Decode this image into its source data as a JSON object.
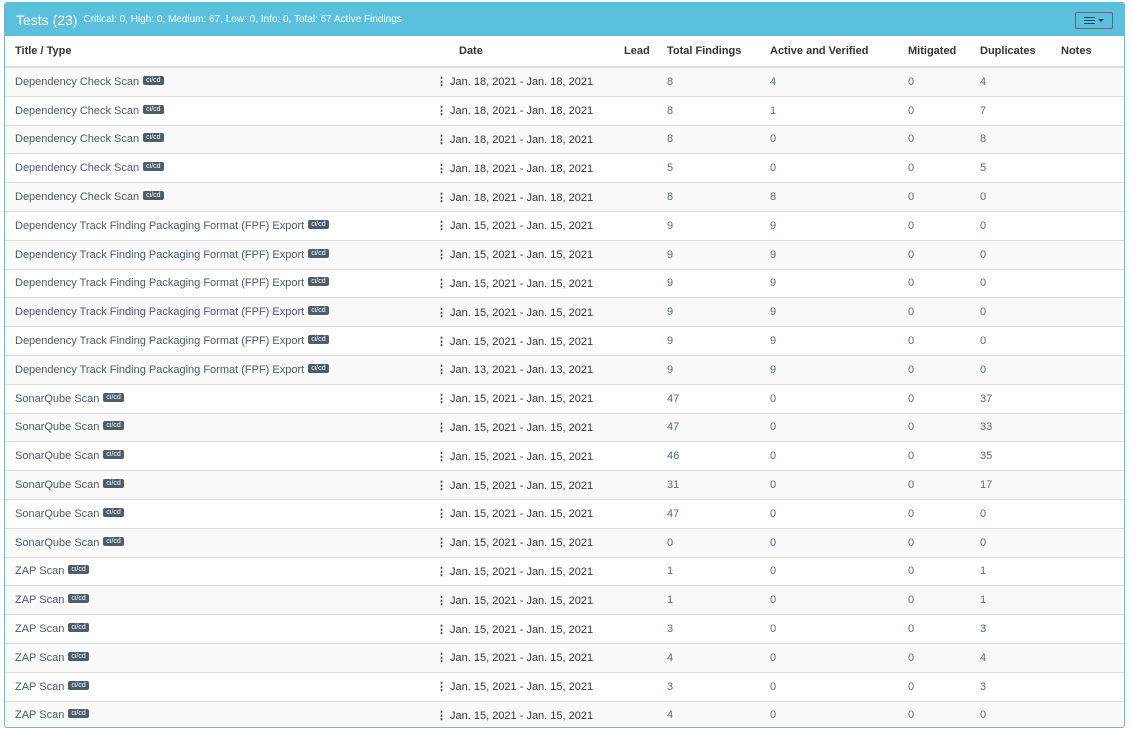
{
  "header": {
    "title": "Tests (23)",
    "summary": "Critical: 0, High: 0, Medium: 67, Low: 0, Info: 0, Total: 67 Active Findings"
  },
  "columns": [
    "Title / Type",
    "Date",
    "Lead",
    "Total Findings",
    "Active and Verified",
    "Mitigated",
    "Duplicates",
    "Notes"
  ],
  "badge_label": "ci/cd",
  "rows": [
    {
      "title": "Dependency Check Scan",
      "date": "Jan. 18, 2021 - Jan. 18, 2021",
      "lead": "",
      "total": "8",
      "active": "4",
      "mitigated": "0",
      "duplicates": "4",
      "notes": ""
    },
    {
      "title": "Dependency Check Scan",
      "date": "Jan. 18, 2021 - Jan. 18, 2021",
      "lead": "",
      "total": "8",
      "active": "1",
      "mitigated": "0",
      "duplicates": "7",
      "notes": ""
    },
    {
      "title": "Dependency Check Scan",
      "date": "Jan. 18, 2021 - Jan. 18, 2021",
      "lead": "",
      "total": "8",
      "active": "0",
      "mitigated": "0",
      "duplicates": "8",
      "notes": ""
    },
    {
      "title": "Dependency Check Scan",
      "date": "Jan. 18, 2021 - Jan. 18, 2021",
      "lead": "",
      "total": "5",
      "active": "0",
      "mitigated": "0",
      "duplicates": "5",
      "notes": ""
    },
    {
      "title": "Dependency Check Scan",
      "date": "Jan. 18, 2021 - Jan. 18, 2021",
      "lead": "",
      "total": "8",
      "active": "8",
      "mitigated": "0",
      "duplicates": "0",
      "notes": ""
    },
    {
      "title": "Dependency Track Finding Packaging Format (FPF) Export",
      "date": "Jan. 15, 2021 - Jan. 15, 2021",
      "lead": "",
      "total": "9",
      "active": "9",
      "mitigated": "0",
      "duplicates": "0",
      "notes": ""
    },
    {
      "title": "Dependency Track Finding Packaging Format (FPF) Export",
      "date": "Jan. 15, 2021 - Jan. 15, 2021",
      "lead": "",
      "total": "9",
      "active": "9",
      "mitigated": "0",
      "duplicates": "0",
      "notes": ""
    },
    {
      "title": "Dependency Track Finding Packaging Format (FPF) Export",
      "date": "Jan. 15, 2021 - Jan. 15, 2021",
      "lead": "",
      "total": "9",
      "active": "9",
      "mitigated": "0",
      "duplicates": "0",
      "notes": ""
    },
    {
      "title": "Dependency Track Finding Packaging Format (FPF) Export",
      "date": "Jan. 15, 2021 - Jan. 15, 2021",
      "lead": "",
      "total": "9",
      "active": "9",
      "mitigated": "0",
      "duplicates": "0",
      "notes": ""
    },
    {
      "title": "Dependency Track Finding Packaging Format (FPF) Export",
      "date": "Jan. 15, 2021 - Jan. 15, 2021",
      "lead": "",
      "total": "9",
      "active": "9",
      "mitigated": "0",
      "duplicates": "0",
      "notes": ""
    },
    {
      "title": "Dependency Track Finding Packaging Format (FPF) Export",
      "date": "Jan. 13, 2021 - Jan. 13, 2021",
      "lead": "",
      "total": "9",
      "active": "9",
      "mitigated": "0",
      "duplicates": "0",
      "notes": ""
    },
    {
      "title": "SonarQube Scan",
      "date": "Jan. 15, 2021 - Jan. 15, 2021",
      "lead": "",
      "total": "47",
      "active": "0",
      "mitigated": "0",
      "duplicates": "37",
      "notes": ""
    },
    {
      "title": "SonarQube Scan",
      "date": "Jan. 15, 2021 - Jan. 15, 2021",
      "lead": "",
      "total": "47",
      "active": "0",
      "mitigated": "0",
      "duplicates": "33",
      "notes": ""
    },
    {
      "title": "SonarQube Scan",
      "date": "Jan. 15, 2021 - Jan. 15, 2021",
      "lead": "",
      "total": "46",
      "active": "0",
      "mitigated": "0",
      "duplicates": "35",
      "notes": ""
    },
    {
      "title": "SonarQube Scan",
      "date": "Jan. 15, 2021 - Jan. 15, 2021",
      "lead": "",
      "total": "31",
      "active": "0",
      "mitigated": "0",
      "duplicates": "17",
      "notes": ""
    },
    {
      "title": "SonarQube Scan",
      "date": "Jan. 15, 2021 - Jan. 15, 2021",
      "lead": "",
      "total": "47",
      "active": "0",
      "mitigated": "0",
      "duplicates": "0",
      "notes": ""
    },
    {
      "title": "SonarQube Scan",
      "date": "Jan. 15, 2021 - Jan. 15, 2021",
      "lead": "",
      "total": "0",
      "active": "0",
      "mitigated": "0",
      "duplicates": "0",
      "notes": ""
    },
    {
      "title": "ZAP Scan",
      "date": "Jan. 15, 2021 - Jan. 15, 2021",
      "lead": "",
      "total": "1",
      "active": "0",
      "mitigated": "0",
      "duplicates": "1",
      "notes": ""
    },
    {
      "title": "ZAP Scan",
      "date": "Jan. 15, 2021 - Jan. 15, 2021",
      "lead": "",
      "total": "1",
      "active": "0",
      "mitigated": "0",
      "duplicates": "1",
      "notes": ""
    },
    {
      "title": "ZAP Scan",
      "date": "Jan. 15, 2021 - Jan. 15, 2021",
      "lead": "",
      "total": "3",
      "active": "0",
      "mitigated": "0",
      "duplicates": "3",
      "notes": ""
    },
    {
      "title": "ZAP Scan",
      "date": "Jan. 15, 2021 - Jan. 15, 2021",
      "lead": "",
      "total": "4",
      "active": "0",
      "mitigated": "0",
      "duplicates": "4",
      "notes": ""
    },
    {
      "title": "ZAP Scan",
      "date": "Jan. 15, 2021 - Jan. 15, 2021",
      "lead": "",
      "total": "3",
      "active": "0",
      "mitigated": "0",
      "duplicates": "3",
      "notes": ""
    },
    {
      "title": "ZAP Scan",
      "date": "Jan. 15, 2021 - Jan. 15, 2021",
      "lead": "",
      "total": "4",
      "active": "0",
      "mitigated": "0",
      "duplicates": "0",
      "notes": ""
    }
  ],
  "icons": {
    "menu": "hamburger-icon",
    "menu_caret": "caret-down-icon",
    "row_actions": "kebab-icon"
  },
  "colors": {
    "header_bg": "#5bc0de",
    "badge_bg": "#4f5d69"
  }
}
